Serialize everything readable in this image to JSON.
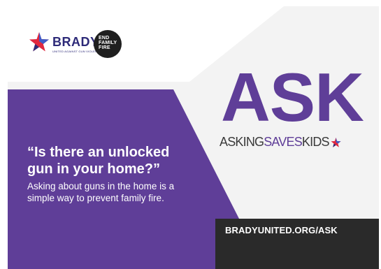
{
  "brand": {
    "brady_name": "BRADY",
    "brady_tagline": "UNITED AGAINST GUN VIOLENCE",
    "end_family_fire": [
      "END",
      "FAMILY",
      "FIRE"
    ]
  },
  "campaign": {
    "title": "ASK",
    "tagline_start": "ASKING",
    "tagline_middle": "SAVES",
    "tagline_end": "KIDS"
  },
  "message": {
    "headline": "“Is there an unlocked gun in your home?”",
    "body": "Asking about guns in the home is a simple way to prevent family fire."
  },
  "footer": {
    "url": "BRADYUNITED.ORG/ASK"
  },
  "colors": {
    "purple": "#5f3e98",
    "navy": "#2d2a78",
    "red": "#e0273e",
    "dark": "#2a2a2a",
    "light_gray": "#f3f3f3"
  }
}
